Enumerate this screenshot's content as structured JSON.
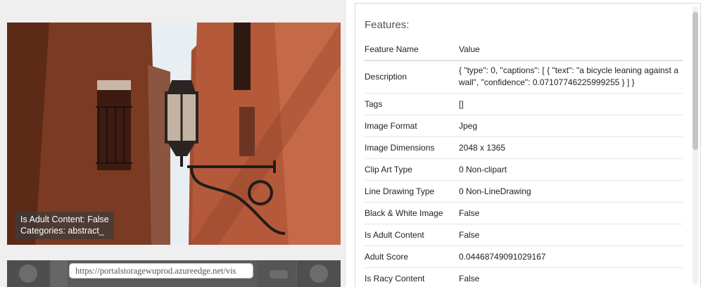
{
  "image_panel": {
    "overlay": {
      "adult_line": "Is Adult Content: False",
      "categories_line": "Categories: abstract_"
    },
    "url_input": {
      "value": "https://portalstoragewuprod.azureedge.net/vis"
    }
  },
  "features_panel": {
    "title": "Features:",
    "columns": [
      "Feature Name",
      "Value"
    ],
    "rows": [
      {
        "name": "Description",
        "value": "{ \"type\": 0, \"captions\": [ { \"text\": \"a bicycle leaning against a wall\", \"confidence\": 0.07107746225999255 } ] }"
      },
      {
        "name": "Tags",
        "value": "[]"
      },
      {
        "name": "Image Format",
        "value": "Jpeg"
      },
      {
        "name": "Image Dimensions",
        "value": "2048 x 1365"
      },
      {
        "name": "Clip Art Type",
        "value": "0 Non-clipart"
      },
      {
        "name": "Line Drawing Type",
        "value": "0 Non-LineDrawing"
      },
      {
        "name": "Black & White Image",
        "value": "False"
      },
      {
        "name": "Is Adult Content",
        "value": "False"
      },
      {
        "name": "Adult Score",
        "value": "0.04468749091029167"
      },
      {
        "name": "Is Racy Content",
        "value": "False"
      }
    ]
  },
  "colors": {
    "wall_left": "#7a3b22",
    "wall_right": "#b4593a",
    "sky": "#e9eef2",
    "lamp": "#2a2522",
    "thumb_strip": "#5b5b5b"
  }
}
